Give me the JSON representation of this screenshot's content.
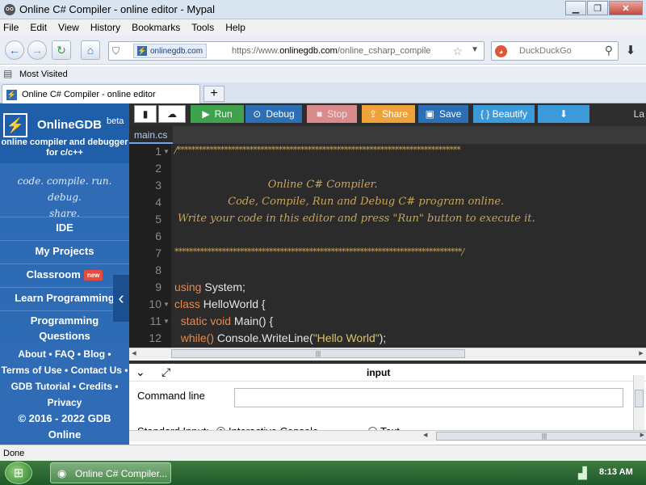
{
  "window": {
    "title": "Online C# Compiler - online editor - Mypal"
  },
  "menu": [
    "File",
    "Edit",
    "View",
    "History",
    "Bookmarks",
    "Tools",
    "Help"
  ],
  "nav": {
    "site_badge": "onlinegdb.com",
    "url_prefix": "https://www.",
    "url_domain": "onlinegdb.com",
    "url_path": "/online_csharp_compile",
    "search_placeholder": "DuckDuckGo"
  },
  "bookmarks": {
    "most_visited": "Most Visited"
  },
  "tab": {
    "title": "Online C# Compiler - online editor",
    "new_tab": "+"
  },
  "sidebar": {
    "brand": "OnlineGDB",
    "beta": "beta",
    "tagline_line1": "online compiler and debugger",
    "tagline_line2": "for c/c++",
    "motto_line1": "code. compile. run. debug.",
    "motto_line2": "share.",
    "items": [
      {
        "label": "IDE"
      },
      {
        "label": "My Projects"
      },
      {
        "label": "Classroom",
        "badge": "new"
      },
      {
        "label": "Learn Programming"
      },
      {
        "label": "Programming"
      },
      {
        "label": "Questions"
      }
    ],
    "links_line1": [
      "About",
      "FAQ",
      "Blog"
    ],
    "links_line2": [
      "Terms of Use",
      "Contact Us"
    ],
    "links_line3": [
      "GDB Tutorial",
      "Credits"
    ],
    "links_line4": "Privacy",
    "copyright_line1": "© 2016 - 2022 GDB",
    "copyright_line2": "Online"
  },
  "toolbar": {
    "run": "Run",
    "debug": "Debug",
    "stop": "Stop",
    "share": "Share",
    "save": "Save",
    "beautify": "{ } Beautify",
    "lang_partial": "La",
    "colors": {
      "run": "#3fa34d",
      "debug": "#2d6fb5",
      "stop": "#d98a8a",
      "share": "#f0a23a",
      "save": "#2d6fb5",
      "beautify": "#3b9ad9",
      "download": "#3b9ad9"
    }
  },
  "editor": {
    "file_tab": "main.cs",
    "line_numbers": [
      "1",
      "2",
      "3",
      "4",
      "5",
      "6",
      "7",
      "8",
      "9",
      "10",
      "11",
      "12"
    ],
    "lines": {
      "l1": "/******************************************************************************",
      "l3": "                            Online C# Compiler.",
      "l4": "                Code, Compile, Run and Debug C# program online.",
      "l5": "Write your code in this editor and press \"Run\" button to execute it.",
      "l7": "*******************************************************************************/",
      "l9_kw": "using",
      "l9_rest": " System;",
      "l10_kw": "class",
      "l10_rest": " HelloWorld {",
      "l11_kw": "  static void",
      "l11_rest": " Main() {",
      "l12_kw": "  while()",
      "l12_mid": " Console.WriteLine(",
      "l12_str": "\"Hello World\"",
      "l12_end": ");"
    }
  },
  "io": {
    "title": "input",
    "command_line_label": "Command line",
    "command_line_value": "",
    "stdin_label": "Standard Input:",
    "interactive": "Interactive Console",
    "text": "Text"
  },
  "status": {
    "text": "Done"
  },
  "taskbar": {
    "item": "Online C# Compiler...",
    "clock": "8:13 AM"
  }
}
